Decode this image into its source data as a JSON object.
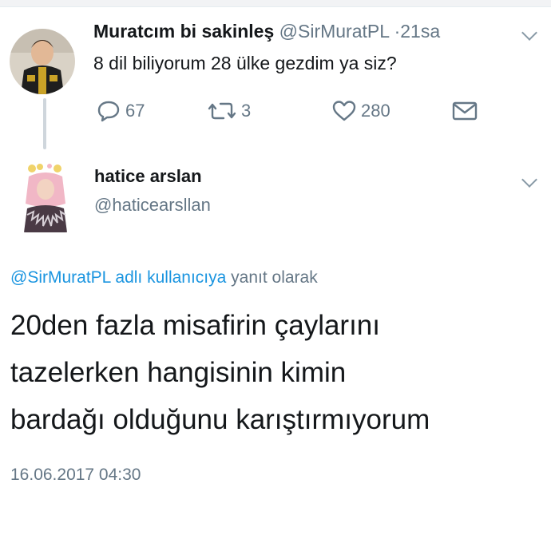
{
  "parent_tweet": {
    "name": "Muratcım bi sakinleş",
    "handle": "@SirMuratPL",
    "separator": "·",
    "time": "21sa",
    "text": "8 dil biliyorum 28 ülke gezdim ya siz?",
    "replies": "67",
    "retweets": "3",
    "likes": "280"
  },
  "reply_tweet": {
    "name": "hatice arslan",
    "handle": "@haticearsllan",
    "replying_mention": "@SirMuratPL adlı kullanıcıya",
    "replying_suffix": "yanıt olarak",
    "text_lines": [
      "20den fazla misafirin çaylarını",
      "tazelerken hangisinin kimin",
      "bardağı olduğunu karıştırmıyorum"
    ],
    "timestamp": "16.06.2017 04:30"
  },
  "icons": {
    "reply": "reply-icon",
    "retweet": "retweet-icon",
    "like": "heart-icon",
    "message": "envelope-icon",
    "caret": "chevron-down-icon"
  },
  "colors": {
    "text": "#14171a",
    "secondary": "#657786",
    "mention": "#1b95e0"
  }
}
